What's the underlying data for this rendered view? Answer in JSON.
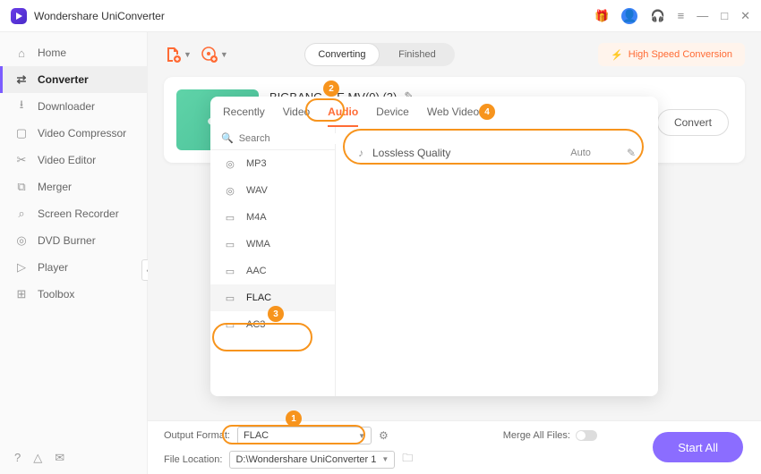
{
  "app": {
    "title": "Wondershare UniConverter"
  },
  "window_controls": {
    "min": "—",
    "max": "□",
    "close": "✕"
  },
  "sidebar": {
    "items": [
      {
        "label": "Home",
        "icon": "⌂"
      },
      {
        "label": "Converter",
        "icon": "⇄"
      },
      {
        "label": "Downloader",
        "icon": "⭳"
      },
      {
        "label": "Video Compressor",
        "icon": "▢"
      },
      {
        "label": "Video Editor",
        "icon": "✂"
      },
      {
        "label": "Merger",
        "icon": "⧉"
      },
      {
        "label": "Screen Recorder",
        "icon": "⌕"
      },
      {
        "label": "DVD Burner",
        "icon": "◎"
      },
      {
        "label": "Player",
        "icon": "▷"
      },
      {
        "label": "Toolbox",
        "icon": "⊞"
      }
    ],
    "active_index": 1
  },
  "toolbar": {
    "seg_converting": "Converting",
    "seg_finished": "Finished",
    "hsc": "High Speed Conversion"
  },
  "card": {
    "title_prefix": "BIGBANG - ",
    "title_suffix": "E MV(0) (3)"
  },
  "panel": {
    "tabs": [
      "Recently",
      "Video",
      "Audio",
      "Device",
      "Web Video"
    ],
    "active_tab_index": 2,
    "search_placeholder": "Search",
    "formats": [
      "MP3",
      "WAV",
      "M4A",
      "WMA",
      "AAC",
      "FLAC",
      "AC3"
    ],
    "active_format_index": 5,
    "quality": {
      "label": "Lossless Quality",
      "value": "Auto"
    }
  },
  "bottom": {
    "output_format_label": "Output Format:",
    "output_format_value": "FLAC",
    "file_location_label": "File Location:",
    "file_location_value": "D:\\Wondershare UniConverter 1",
    "merge_label": "Merge All Files:",
    "start_all": "Start All"
  },
  "markers": {
    "1": "1",
    "2": "2",
    "3": "3",
    "4": "4"
  }
}
